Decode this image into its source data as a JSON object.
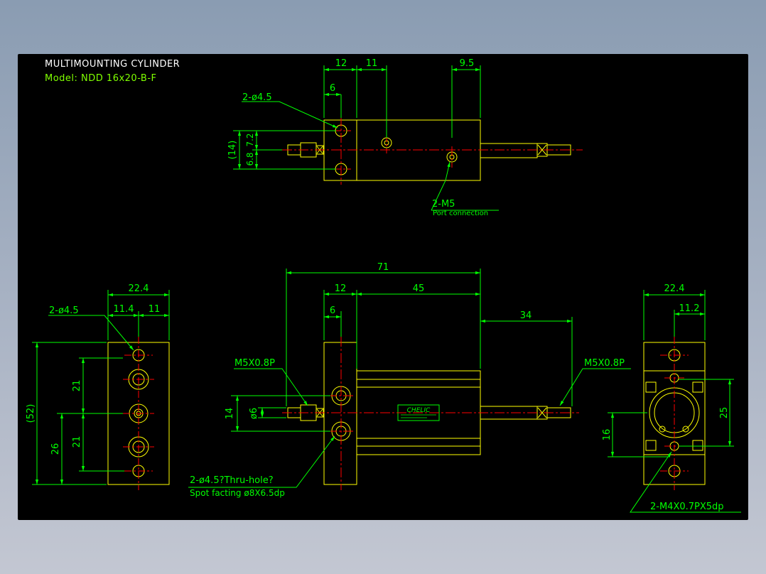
{
  "title": "MULTIMOUNTING CYLINDER",
  "model": "Model: NDD 16x20-B-F",
  "colors": {
    "background": "#000000",
    "outline": "#ffff00",
    "dimension": "#00ff00",
    "centerline": "#ff0000",
    "text": "#ffffff"
  },
  "top_view": {
    "dims": {
      "d12": "12",
      "d11": "11",
      "d9_5": "9.5",
      "d6": "6",
      "d14": "(14)",
      "d6_8": "6.8",
      "d7_2": "7.2"
    },
    "holes_label": "2-ø4.5",
    "port_label": "2-M5",
    "port_note": "Port connection"
  },
  "left_view": {
    "dims": {
      "w22_4": "22.4",
      "w11_4": "11.4",
      "w11": "11",
      "h52": "(52)",
      "h26": "26",
      "h21a": "21",
      "h21b": "21"
    },
    "holes_label": "2-ø4.5"
  },
  "front_view": {
    "dims": {
      "l71": "71",
      "l12": "12",
      "l45": "45",
      "l6": "6",
      "l34": "34",
      "h14": "14",
      "h6": "ø6"
    },
    "port_left": "M5X0.8P",
    "port_right": "M5X0.8P",
    "brand": "CHELIC",
    "hole_note_1": "2-ø4.5?Thru-hole?",
    "hole_note_2": "Spot facting  ø8X6.5dp"
  },
  "right_view": {
    "dims": {
      "w22_4": "22.4",
      "w11_2": "11.2",
      "h25": "25",
      "h16": "16"
    },
    "tap_label": "2-M4X0.7PX5dp"
  }
}
